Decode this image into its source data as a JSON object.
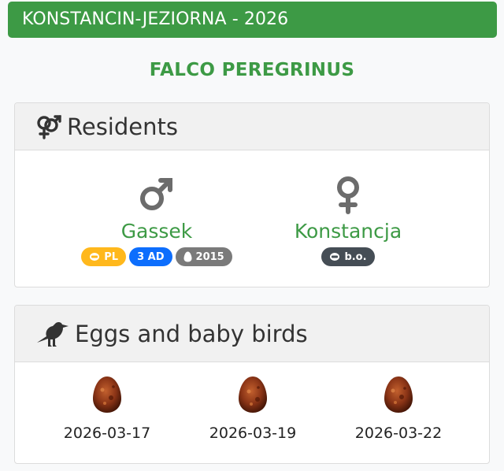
{
  "header": {
    "title": "KONSTANCIN-JEZIORNA - 2026"
  },
  "species": {
    "name": "FALCO PEREGRINUS"
  },
  "residents": {
    "title": "Residents",
    "icon": "male-female-icon",
    "male": {
      "icon": "male-icon",
      "name": "Gassek",
      "badges": [
        {
          "icon": "ring-icon",
          "text": "PL",
          "color": "#ffb81c"
        },
        {
          "icon": "",
          "text": "3 AD",
          "color": "#0d6efd"
        },
        {
          "icon": "egg-icon",
          "text": "2015",
          "color": "#7a7a7a"
        }
      ]
    },
    "female": {
      "icon": "female-icon",
      "name": "Konstancja",
      "badges": [
        {
          "icon": "ring-icon",
          "text": "b.o.",
          "color": "#454d55"
        }
      ]
    }
  },
  "eggs": {
    "title": "Eggs and baby birds",
    "icon": "crow-icon",
    "items": [
      {
        "date": "2026-03-17"
      },
      {
        "date": "2026-03-19"
      },
      {
        "date": "2026-03-22"
      }
    ]
  }
}
